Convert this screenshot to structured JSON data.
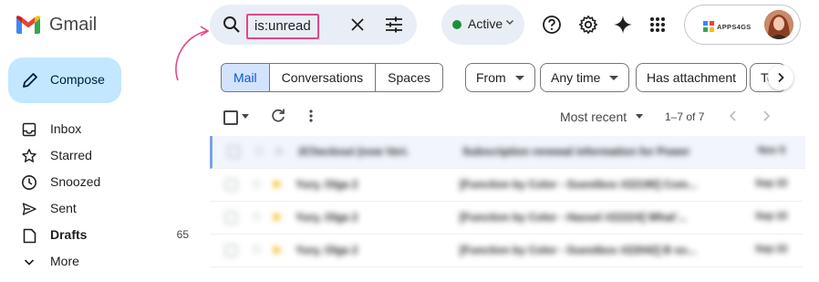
{
  "app": {
    "name": "Gmail"
  },
  "search": {
    "query": "is:unread"
  },
  "status": {
    "label": "Active",
    "color": "#1e8e3e"
  },
  "account": {
    "org_name": "APPS4GS"
  },
  "compose": {
    "label": "Compose"
  },
  "sidebar": {
    "items": [
      {
        "label": "Inbox",
        "icon": "inbox-icon",
        "count": ""
      },
      {
        "label": "Starred",
        "icon": "star-icon",
        "count": ""
      },
      {
        "label": "Snoozed",
        "icon": "clock-icon",
        "count": ""
      },
      {
        "label": "Sent",
        "icon": "send-icon",
        "count": ""
      },
      {
        "label": "Drafts",
        "icon": "draft-icon",
        "count": "65"
      },
      {
        "label": "More",
        "icon": "chevron-down-icon",
        "count": ""
      }
    ]
  },
  "tabs": [
    "Mail",
    "Conversations",
    "Spaces"
  ],
  "filters": {
    "from": "From",
    "time": "Any time",
    "attachment": "Has attachment",
    "to": "To"
  },
  "toolbar": {
    "sort": "Most recent",
    "range": "1–7 of 7"
  },
  "emails": [
    {
      "sender": "2Checkout (now Veri.",
      "subject": "Subscription renewal information for Power",
      "date": "Nov 5"
    },
    {
      "sender": "Yury, Olga 2",
      "subject": "[Function by Color - Guestbox #22190] Com...",
      "date": "Sep 22"
    },
    {
      "sender": "Yury, Olga 2",
      "subject": "[Function by Color - Hassel #22224] What'...",
      "date": "Sep 22"
    },
    {
      "sender": "Yury, Olga 2",
      "subject": "[Function by Color - Guestbox #22042] B so...",
      "date": "Sep 22"
    }
  ],
  "colors": {
    "accent": "#0b57d0",
    "compose_bg": "#c2e7ff",
    "annotation": "#e54689"
  }
}
